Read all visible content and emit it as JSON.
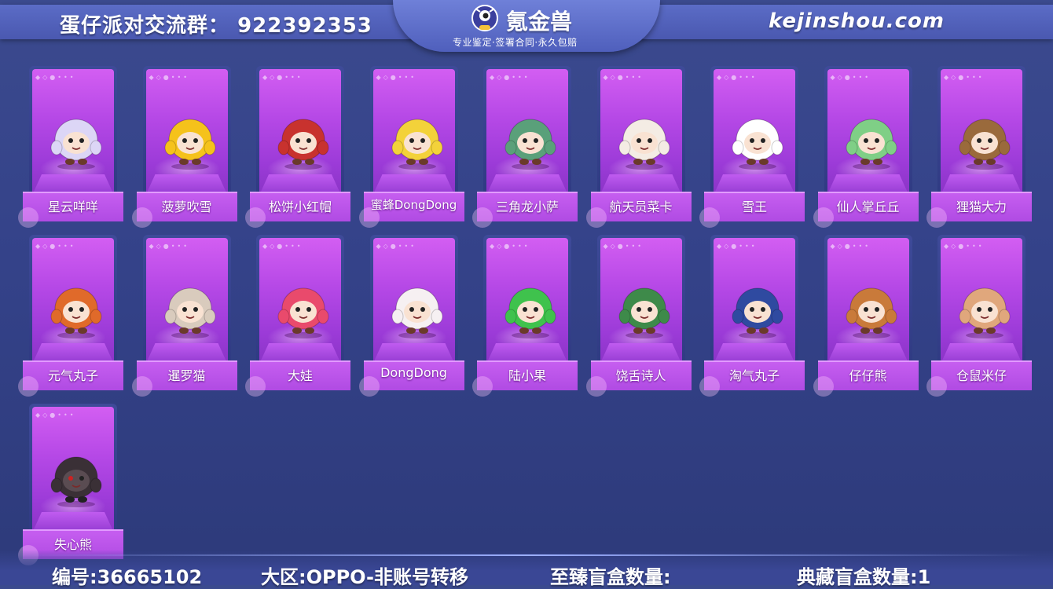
{
  "header": {
    "group_label": "蛋仔派对交流群：",
    "group_number": "922392353",
    "logo_text": "氪金兽",
    "slogan": "专业鉴定·签署合同·永久包赔",
    "site": "kejinshou.com"
  },
  "skins": [
    {
      "name": "星云咩咩",
      "icon": "cloud-sheep-figure",
      "color": "#dcd6f6"
    },
    {
      "name": "菠萝吹雪",
      "icon": "pineapple-figure",
      "color": "#f5c21b"
    },
    {
      "name": "松饼小红帽",
      "icon": "red-hood-figure",
      "color": "#c8322e"
    },
    {
      "name": "蜜蜂DongDong",
      "icon": "bee-figure",
      "color": "#f3d23a"
    },
    {
      "name": "三角龙小萨",
      "icon": "dragon-figure",
      "color": "#5aa07a"
    },
    {
      "name": "航天员菜卡",
      "icon": "astronaut-cat-figure",
      "color": "#f4ece4"
    },
    {
      "name": "雪王",
      "icon": "snow-king-figure",
      "color": "#ffffff"
    },
    {
      "name": "仙人掌丘丘",
      "icon": "cactus-figure",
      "color": "#7fcf86"
    },
    {
      "name": "狸猫大力",
      "icon": "raccoon-figure",
      "color": "#9a6a3c"
    },
    {
      "name": "元气丸子",
      "icon": "girl-figure",
      "color": "#e06a2a"
    },
    {
      "name": "暹罗猫",
      "icon": "siamese-cat-figure",
      "color": "#d9cbbd"
    },
    {
      "name": "大娃",
      "icon": "calabash-boy-figure",
      "color": "#e94a6c"
    },
    {
      "name": "DongDong",
      "icon": "sheep-figure",
      "color": "#f6f0f2"
    },
    {
      "name": "陆小果",
      "icon": "green-fruit-figure",
      "color": "#3fc24d"
    },
    {
      "name": "饶舌诗人",
      "icon": "rapper-figure",
      "color": "#3e8a4a"
    },
    {
      "name": "淘气丸子",
      "icon": "schoolgirl-figure",
      "color": "#2f4aa0"
    },
    {
      "name": "仔仔熊",
      "icon": "teddy-bear-figure",
      "color": "#c97a3a"
    },
    {
      "name": "仓鼠米仔",
      "icon": "hamster-figure",
      "color": "#e0a77c"
    },
    {
      "name": "失心熊",
      "icon": "dark-bear-figure",
      "color": "#3a3036"
    }
  ],
  "footer": {
    "id_label": "编号:36665102",
    "region_label": "大区:OPPO-非账号转移",
    "supreme_label": "至臻盲盒数量:",
    "collection_label": "典藏盲盒数量:1"
  }
}
